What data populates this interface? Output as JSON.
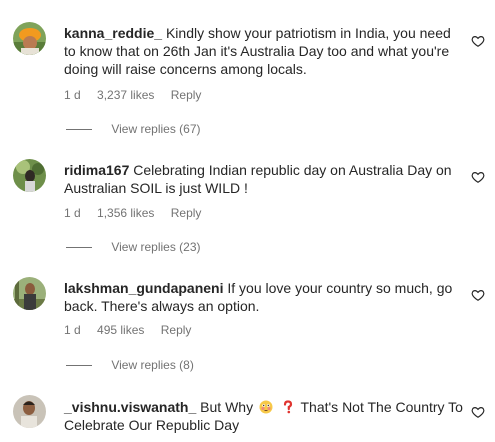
{
  "comments": [
    {
      "username": "kanna_reddie_",
      "text": "Kindly show your patriotism in India, you need to know that on 26th Jan it's Australia Day too and what you're doing will raise concerns among locals.",
      "time": "1 d",
      "likes": "3,237 likes",
      "reply_label": "Reply",
      "view_replies": "View replies (67)",
      "avatar_icon": "avatar-orange-turban"
    },
    {
      "username": "ridima167",
      "text": "Celebrating Indian republic day on Australia Day on Australian SOIL is just WILD !",
      "time": "1 d",
      "likes": "1,356 likes",
      "reply_label": "Reply",
      "view_replies": "View replies (23)",
      "avatar_icon": "avatar-green-photo"
    },
    {
      "username": "lakshman_gundapaneni",
      "text": "If you love your country so much, go back. There's always an option.",
      "time": "1 d",
      "likes": "495 likes",
      "reply_label": "Reply",
      "view_replies": "View replies (8)",
      "avatar_icon": "avatar-person-outdoor"
    },
    {
      "username": "_vishnu.viswanath_",
      "text_before": "But Why",
      "text_after": "That's Not The Country To Celebrate Our Republic Day",
      "emojis": [
        "flushed-face-emoji",
        "red-question-mark-emoji"
      ],
      "avatar_icon": "avatar-person-portrait"
    }
  ],
  "icons": {
    "like": "heart-outline-icon"
  },
  "colors": {
    "text": "#262626",
    "secondary": "#737373"
  }
}
